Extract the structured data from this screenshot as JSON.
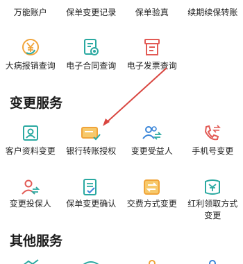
{
  "row_top": [
    "万能账户",
    "保单变更记录",
    "保单验真",
    "续期续保转账"
  ],
  "row_second": [
    "大病报销查询",
    "电子合同查询",
    "电子发票查询"
  ],
  "section_change": {
    "title": "变更服务",
    "items": [
      {
        "label": "客户资料变更",
        "icon": "id-card-icon"
      },
      {
        "label": "银行转账授权",
        "icon": "bank-card-check-icon"
      },
      {
        "label": "变更受益人",
        "icon": "users-transfer-icon"
      },
      {
        "label": "手机号变更",
        "icon": "phone-transfer-icon"
      },
      {
        "label": "变更投保人",
        "icon": "user-transfer-icon"
      },
      {
        "label": "保单变更确认",
        "icon": "document-check-icon"
      },
      {
        "label": "交费方式变更",
        "icon": "payment-transfer-icon"
      },
      {
        "label": "红利领取方式变更",
        "icon": "bonus-transfer-icon"
      }
    ]
  },
  "section_other": {
    "title": "其他服务"
  },
  "colors": {
    "teal": "#2aa9a1",
    "orange": "#f0a43a",
    "red": "#e25a55",
    "blue": "#3b86d9",
    "arrow": "#d94640"
  }
}
